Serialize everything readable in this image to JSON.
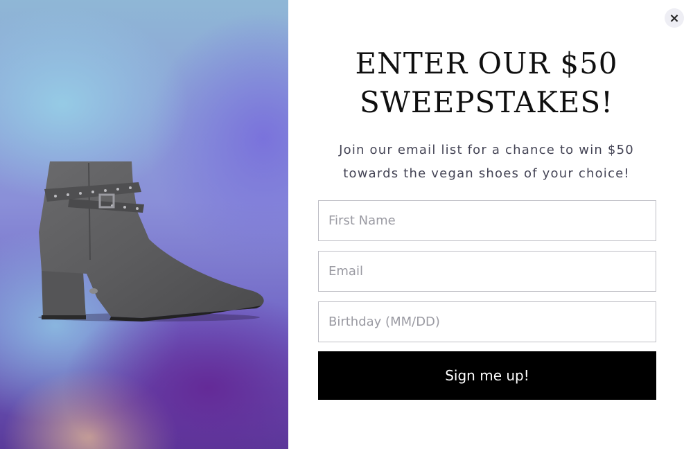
{
  "popup": {
    "close_glyph": "×",
    "headline": "ENTER OUR $50 SWEEPSTAKES!",
    "subtext": "Join our email list for a chance to win $50 towards the vegan shoes of your choice!",
    "fields": {
      "first_name_placeholder": "First Name",
      "email_placeholder": "Email",
      "birthday_placeholder": "Birthday (MM/DD)"
    },
    "submit_label": "Sign me up!"
  },
  "image": {
    "subject": "boot-image"
  },
  "colors": {
    "button_bg": "#000000",
    "button_text": "#ffffff",
    "headline": "#0f0f0f"
  }
}
